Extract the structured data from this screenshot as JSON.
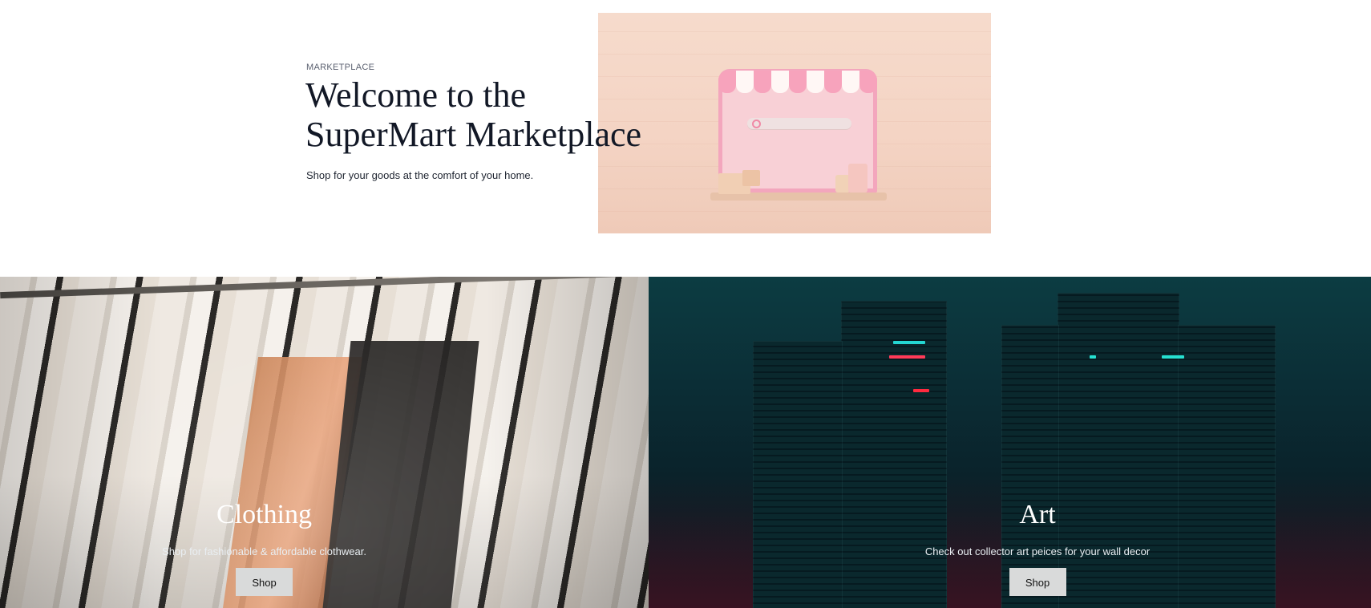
{
  "hero": {
    "eyebrow": "MARKETPLACE",
    "title": "Welcome to the SuperMart Marketplace",
    "subtitle": "Shop for your goods at the comfort of your home."
  },
  "categories": [
    {
      "title": "Clothing",
      "description": "Shop for fashionable & affordable clothwear.",
      "button_label": "Shop"
    },
    {
      "title": "Art",
      "description": "Check out collector art peices for your wall decor",
      "button_label": "Shop"
    }
  ],
  "colors": {
    "title_text": "#121826",
    "button_bg": "#d9dada",
    "hero_image_bg": "#f6dbcc",
    "art_panel_bg": "#0b2d35"
  },
  "icons": {
    "hero_image": "storefront-illustration",
    "clothing_image": "clothing-rack-photo",
    "art_image": "city-night-photo"
  }
}
